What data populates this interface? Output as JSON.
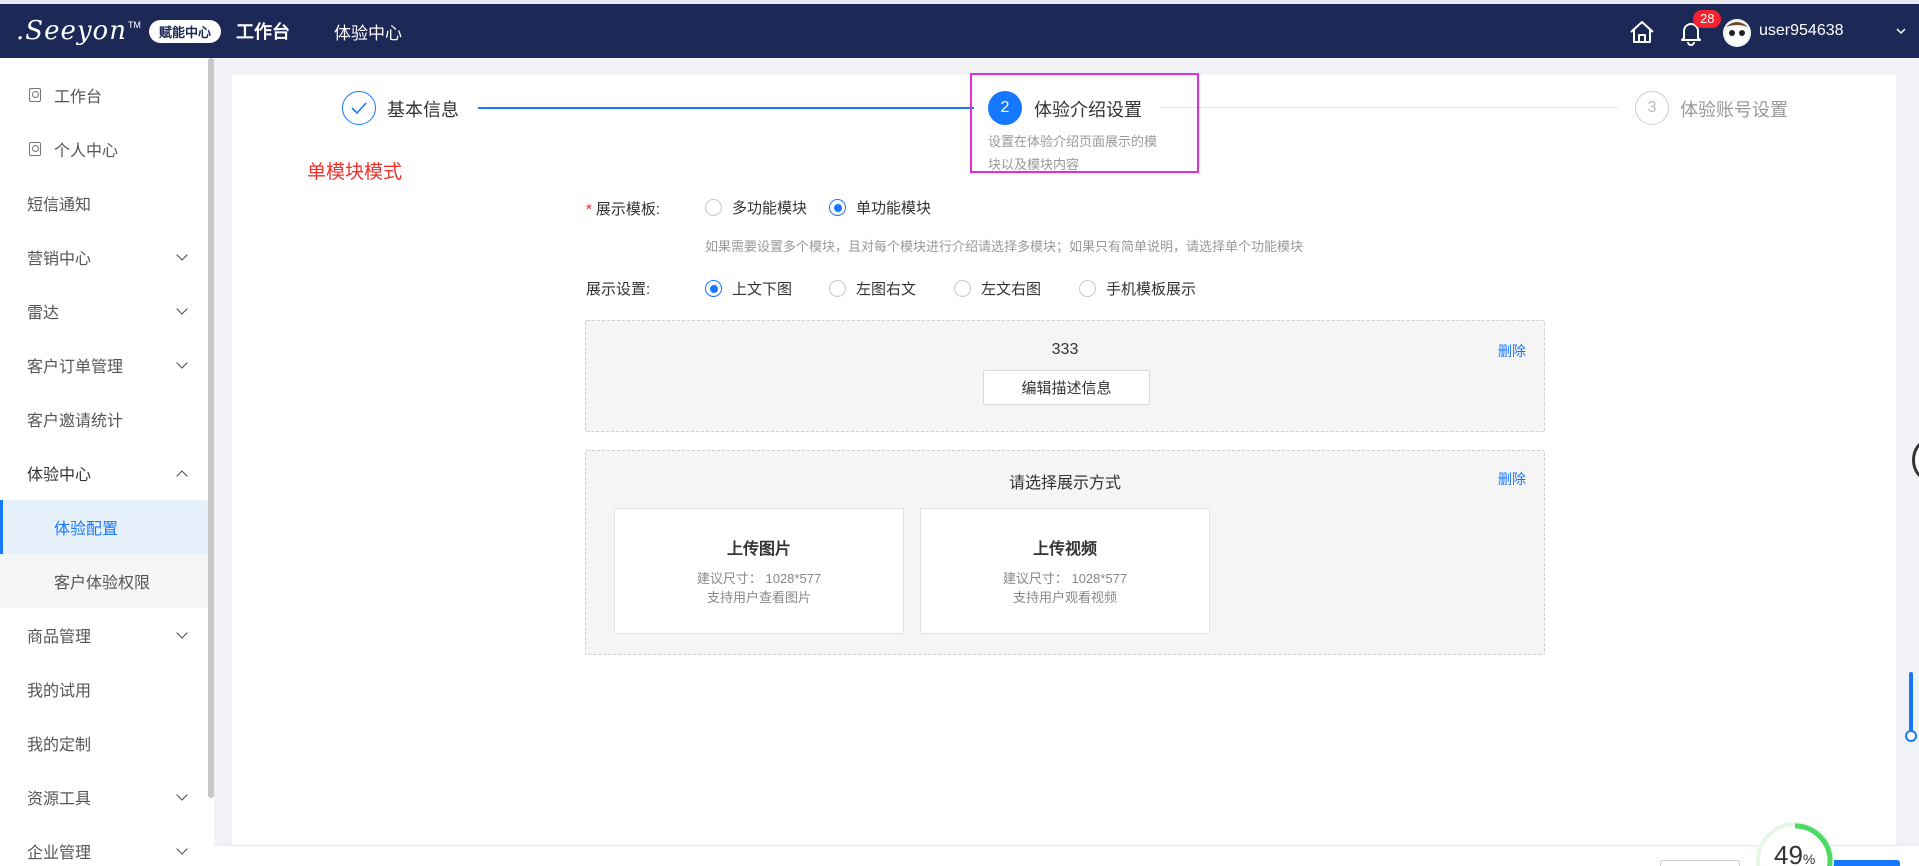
{
  "brand": {
    "logo_text": ".Seeyon",
    "logo_tm": "TM",
    "badge": "赋能中心"
  },
  "topnav": {
    "items": [
      {
        "label": "工作台",
        "active": true
      },
      {
        "label": "体验中心",
        "active": false
      }
    ]
  },
  "user": {
    "notifications": "28",
    "name": "user954638"
  },
  "sidebar": {
    "items": [
      {
        "label": "工作台",
        "icon": "pin-icon"
      },
      {
        "label": "个人中心",
        "icon": "pin-icon"
      },
      {
        "label": "短信通知"
      },
      {
        "label": "营销中心",
        "expandable": true
      },
      {
        "label": "雷达",
        "expandable": true
      },
      {
        "label": "客户订单管理",
        "expandable": true
      },
      {
        "label": "客户邀请统计"
      },
      {
        "label": "体验中心",
        "expandable": true,
        "expanded": true
      },
      {
        "label": "体验配置",
        "sub": true,
        "active": true
      },
      {
        "label": "客户体验权限",
        "sub": true
      },
      {
        "label": "商品管理",
        "expandable": true
      },
      {
        "label": "我的试用"
      },
      {
        "label": "我的定制"
      },
      {
        "label": "资源工具",
        "expandable": true
      },
      {
        "label": "企业管理",
        "expandable": true
      }
    ]
  },
  "steps": [
    {
      "number": "✓",
      "title": "基本信息",
      "status": "done"
    },
    {
      "number": "2",
      "title": "体验介绍设置",
      "status": "active",
      "description": "设置在体验介绍页面展示的模块以及模块内容"
    },
    {
      "number": "3",
      "title": "体验账号设置",
      "status": "pending"
    }
  ],
  "mode_label": "单模块模式",
  "form": {
    "template_label": "展示模板:",
    "template_options": [
      "多功能模块",
      "单功能模块"
    ],
    "template_selected": "单功能模块",
    "hint": "如果需要设置多个模块，且对每个模块进行介绍请选择多模块；如果只有简单说明，请选择单个功能模块",
    "display_label": "展示设置:",
    "display_options": [
      "上文下图",
      "左图右文",
      "左文右图",
      "手机模板展示"
    ],
    "display_selected": "上文下图"
  },
  "modules": [
    {
      "title": "333",
      "delete": "删除",
      "edit_button": "编辑描述信息"
    },
    {
      "title": "请选择展示方式",
      "delete": "删除",
      "cards": [
        {
          "title": "上传图片",
          "size": "建议尺寸： 1028*577",
          "note": "支持用户查看图片"
        },
        {
          "title": "上传视频",
          "size": "建议尺寸： 1028*577",
          "note": "支持用户观看视频"
        }
      ]
    }
  ],
  "progress": {
    "value": "49",
    "unit": "%"
  },
  "colors": {
    "topbar": "#1c2957",
    "accent": "#1677ff",
    "highlight": "#e52bdc",
    "mode_label": "#f0322b"
  }
}
